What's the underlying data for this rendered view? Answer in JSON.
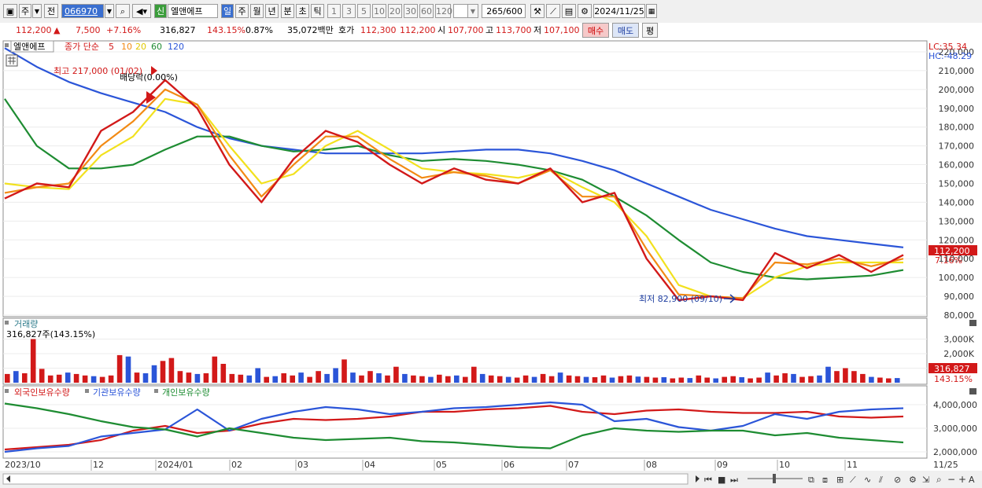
{
  "toolbar": {
    "period_type": "주",
    "prev_label": "전",
    "stock_code": "066970",
    "new_badge": "신",
    "stock_name": "엘앤에프",
    "period_tabs": [
      "일",
      "주",
      "월",
      "년",
      "분",
      "초",
      "틱"
    ],
    "minute_options": [
      "1",
      "3",
      "5",
      "10",
      "20",
      "30",
      "60",
      "120"
    ],
    "count": "265",
    "count_max": "/600",
    "date": "2024/11/25"
  },
  "quote": {
    "price": "112,200",
    "change": "7,500",
    "change_pct": "+7.16%",
    "volume": "316,827",
    "volume_ratio": "143.15%",
    "turnover": "0.87%",
    "amount": "35,072백만",
    "ask_label": "호가",
    "ask": "112,300",
    "bid": "112,200",
    "open_label": "시",
    "open": "107,700",
    "high_label": "고",
    "high": "113,700",
    "low_label": "저",
    "low": "107,100",
    "buy_label": "매수",
    "sell_label": "매도",
    "eval_label": "평"
  },
  "legend": {
    "name": "엘앤에프",
    "ma_label": "종가 단순",
    "ma_periods": [
      "5",
      "10",
      "20",
      "60",
      "120"
    ],
    "ma_colors": [
      "#d21919",
      "#f28a14",
      "#f2e11e",
      "#1e8c32",
      "#2b55d8"
    ]
  },
  "annotations": {
    "high_text": "최고 217,000 (01/02)",
    "dividend_text": "배당락(0.00%)",
    "low_text": "최저 82,900 (09/10)",
    "lc": "LC:35.34",
    "hc": "HC:-48.29"
  },
  "volume_panel": {
    "title": "거래량",
    "current": "316,827주(143.15%)",
    "label_value": "316,827",
    "label_pct": "143.15%"
  },
  "holdings_panel": {
    "series_names": [
      "외국인보유수량",
      "기관보유수량",
      "개인보유수량"
    ]
  },
  "chart_data": [
    {
      "type": "line",
      "title": "엘앤에프",
      "price_label": "112,200",
      "price_change": "7.16%",
      "ylim": [
        80000,
        225000
      ],
      "yticks": [
        80000,
        90000,
        100000,
        110000,
        120000,
        130000,
        140000,
        150000,
        160000,
        170000,
        180000,
        190000,
        200000,
        210000,
        220000
      ],
      "ytick_labels": [
        "80,000",
        "90,000",
        "100,000",
        "110,000",
        "120,000",
        "130,000",
        "140,000",
        "150,000",
        "160,000",
        "170,000",
        "180,000",
        "190,000",
        "200,000",
        "210,000",
        "220,000"
      ],
      "x": [
        "2023/10",
        "12",
        "2024/01",
        "02",
        "03",
        "04",
        "05",
        "06",
        "07",
        "08",
        "09",
        "10",
        "11",
        "11/25"
      ],
      "series": [
        {
          "name": "5",
          "color": "#d21919",
          "values": [
            142000,
            150000,
            148000,
            178000,
            188000,
            205000,
            190000,
            160000,
            140000,
            163000,
            178000,
            172000,
            160000,
            150000,
            158000,
            152000,
            150000,
            158000,
            140000,
            145000,
            110000,
            88000,
            90000,
            88000,
            113000,
            105000,
            112000,
            103000,
            112000
          ]
        },
        {
          "name": "10",
          "color": "#f28a14",
          "values": [
            145000,
            148000,
            150000,
            170000,
            183000,
            200000,
            192000,
            165000,
            143000,
            160000,
            175000,
            175000,
            163000,
            153000,
            156000,
            154000,
            150000,
            157000,
            143000,
            143000,
            115000,
            91000,
            90000,
            89000,
            108000,
            107000,
            110000,
            106000,
            110000
          ]
        },
        {
          "name": "20",
          "color": "#f2e11e",
          "values": [
            150000,
            148000,
            147000,
            165000,
            175000,
            195000,
            192000,
            170000,
            150000,
            155000,
            170000,
            178000,
            168000,
            158000,
            156000,
            155000,
            153000,
            157000,
            148000,
            140000,
            122000,
            96000,
            90000,
            89000,
            100000,
            106000,
            108000,
            108000,
            108000
          ]
        },
        {
          "name": "60",
          "color": "#1e8c32",
          "values": [
            195000,
            170000,
            158000,
            158000,
            160000,
            168000,
            175000,
            175000,
            170000,
            167000,
            168000,
            170000,
            165000,
            162000,
            163000,
            162000,
            160000,
            157000,
            152000,
            143000,
            133000,
            120000,
            108000,
            103000,
            100000,
            99000,
            100000,
            101000,
            104000
          ]
        },
        {
          "name": "120",
          "color": "#2b55d8",
          "values": [
            222000,
            212000,
            204000,
            198000,
            193000,
            188000,
            180000,
            174000,
            170000,
            168000,
            166000,
            166000,
            166000,
            166000,
            167000,
            168000,
            168000,
            166000,
            162000,
            157000,
            150000,
            143000,
            136000,
            131000,
            126000,
            122000,
            120000,
            118000,
            116000
          ]
        }
      ]
    },
    {
      "type": "bar",
      "title": "거래량",
      "ylim": [
        0,
        3300
      ],
      "yticks": [
        1000,
        2000,
        3000
      ],
      "ytick_labels": [
        "1,000K",
        "2,000K",
        "3,000K"
      ],
      "values": [
        600,
        800,
        650,
        3000,
        950,
        500,
        550,
        700,
        600,
        500,
        450,
        400,
        500,
        1900,
        1800,
        700,
        650,
        1200,
        1500,
        1700,
        800,
        700,
        600,
        650,
        1800,
        1300,
        600,
        550,
        500,
        1000,
        400,
        450,
        650,
        500,
        700,
        400,
        800,
        600,
        1000,
        1600,
        700,
        500,
        800,
        650,
        500,
        1100,
        600,
        500,
        450,
        400,
        550,
        450,
        500,
        400,
        1100,
        600,
        500,
        450,
        400,
        350,
        500,
        400,
        600,
        450,
        700,
        500,
        450,
        400,
        380,
        500,
        350,
        450,
        500,
        420,
        400,
        350,
        380,
        300,
        350,
        320,
        500,
        350,
        300,
        400,
        450,
        380,
        300,
        350,
        700,
        500,
        650,
        600,
        400,
        450,
        500,
        1100,
        800,
        1000,
        800,
        600,
        400,
        350,
        300,
        320
      ],
      "colors_up_down": [
        "#d21919",
        "#2b55d8"
      ]
    },
    {
      "type": "line",
      "title": "외국인보유수량 기관보유수량 개인보유수량",
      "ylim": [
        1800000,
        4500000
      ],
      "yticks": [
        2000000,
        3000000,
        4000000
      ],
      "ytick_labels": [
        "2,000,000",
        "3,000,000",
        "4,000,000"
      ],
      "series": [
        {
          "name": "외국인보유수량",
          "color": "#d21919",
          "values": [
            2100000,
            2200000,
            2300000,
            2500000,
            2900000,
            3100000,
            2800000,
            2900000,
            3200000,
            3400000,
            3350000,
            3400000,
            3500000,
            3700000,
            3700000,
            3800000,
            3850000,
            3950000,
            3700000,
            3600000,
            3750000,
            3800000,
            3700000,
            3650000,
            3650000,
            3700000,
            3500000,
            3450000,
            3500000
          ]
        },
        {
          "name": "기관보유수량",
          "color": "#2b55d8",
          "values": [
            2000000,
            2150000,
            2250000,
            2650000,
            2800000,
            2950000,
            3800000,
            2900000,
            3400000,
            3700000,
            3900000,
            3800000,
            3600000,
            3700000,
            3850000,
            3900000,
            4000000,
            4100000,
            4000000,
            3300000,
            3400000,
            3050000,
            2900000,
            3100000,
            3600000,
            3400000,
            3700000,
            3800000,
            3850000
          ]
        },
        {
          "name": "개인보유수량",
          "color": "#1e8c32",
          "values": [
            4050000,
            3850000,
            3600000,
            3300000,
            3050000,
            2950000,
            2650000,
            3000000,
            2800000,
            2600000,
            2500000,
            2550000,
            2600000,
            2450000,
            2400000,
            2300000,
            2200000,
            2150000,
            2700000,
            3000000,
            2900000,
            2850000,
            2900000,
            2900000,
            2700000,
            2800000,
            2600000,
            2500000,
            2400000
          ]
        }
      ]
    }
  ],
  "x_axis": {
    "labels": [
      "2023/10",
      "12",
      "2024/01",
      "02",
      "03",
      "04",
      "05",
      "06",
      "07",
      "08",
      "09",
      "10",
      "11",
      "11/25"
    ]
  },
  "bottom_toolbar": {
    "zoom_label": "A"
  }
}
